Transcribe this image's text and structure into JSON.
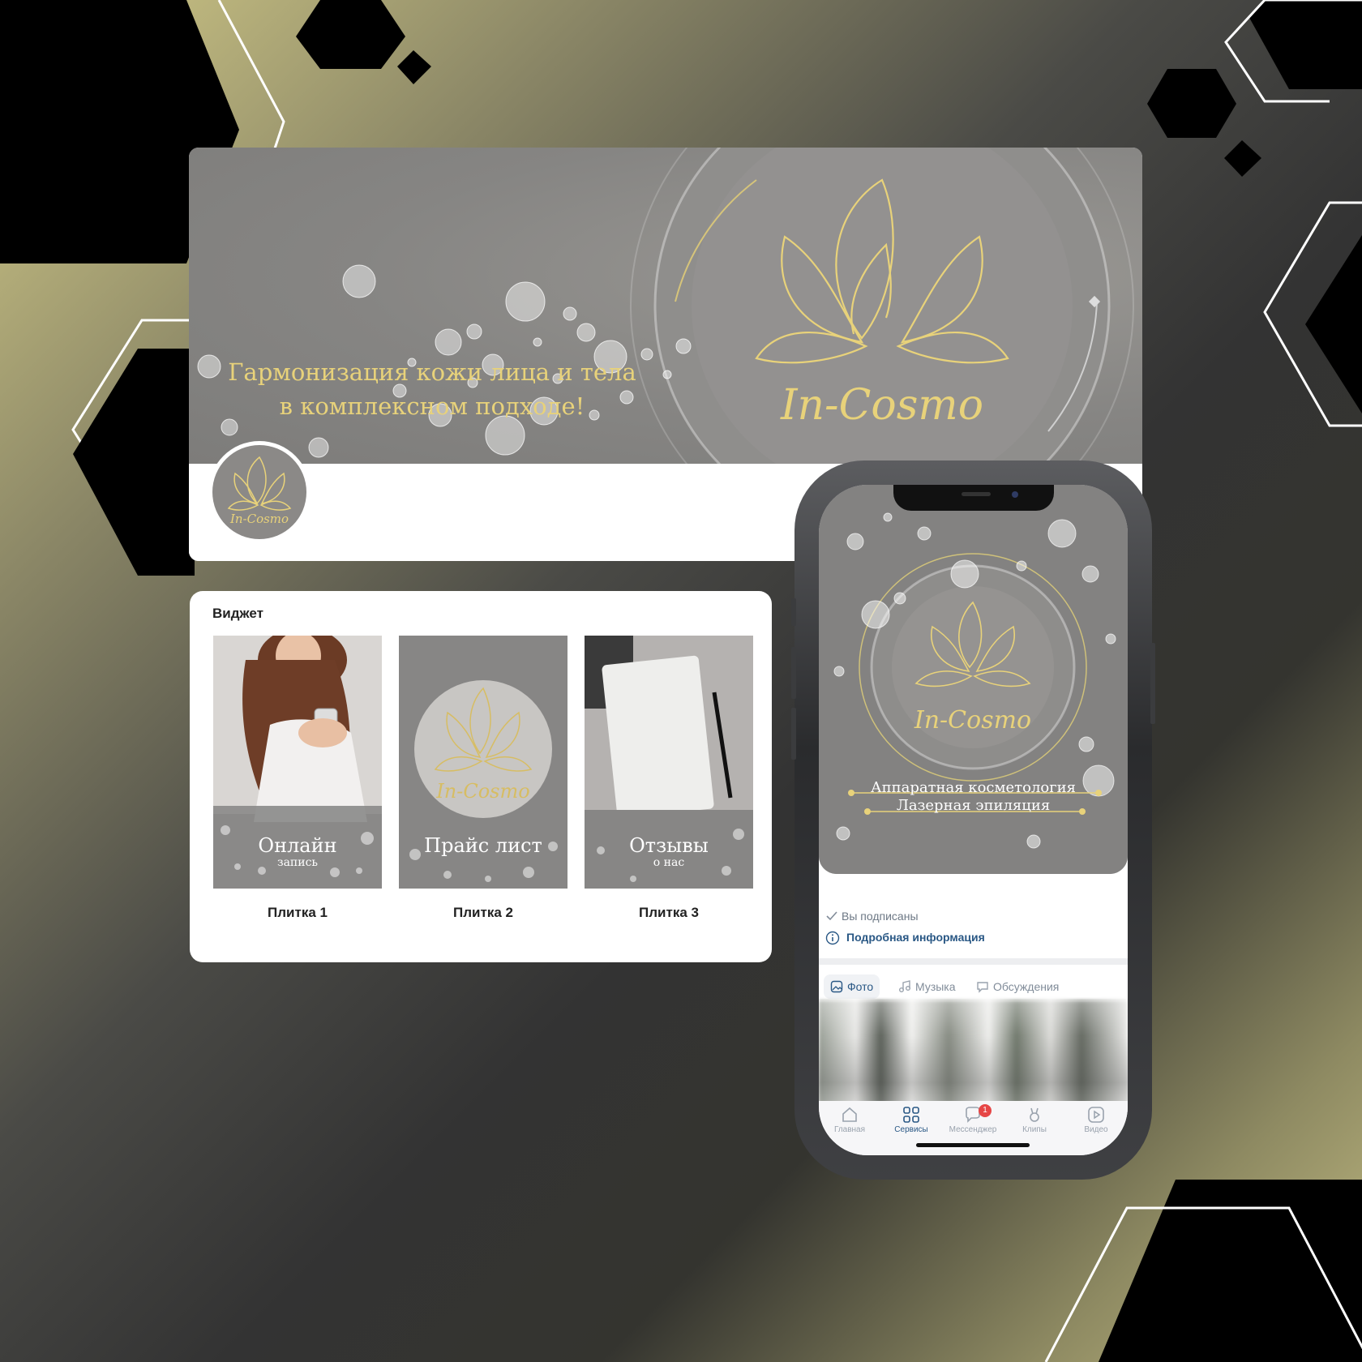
{
  "cover": {
    "tagline_line1": "Гармонизация кожи лица и тела",
    "tagline_line2": "в комплексном подходе!",
    "logo_text": "In-Cosmo"
  },
  "widget": {
    "title": "Виджет",
    "tiles": [
      {
        "title": "Онлайн",
        "subtitle": "запись",
        "caption": "Плитка 1"
      },
      {
        "title": "Прайс лист",
        "subtitle": "",
        "caption": "Плитка 2",
        "logo_text": "In-Cosmo"
      },
      {
        "title": "Отзывы",
        "subtitle": "о нас",
        "caption": "Плитка 3"
      }
    ]
  },
  "phone": {
    "logo_text": "In-Cosmo",
    "cover_line1": "Аппаратная косметология",
    "cover_line2": "Лазерная эпиляция",
    "subscribed": "Вы подписаны",
    "info_link": "Подробная информация",
    "tabs": [
      {
        "label": "Фото",
        "icon": "image-icon",
        "active": true
      },
      {
        "label": "Музыка",
        "icon": "music-note-icon",
        "active": false
      },
      {
        "label": "Обсуждения",
        "icon": "comment-icon",
        "active": false
      }
    ],
    "nav": [
      {
        "label": "Главная",
        "icon": "home-icon",
        "active": false
      },
      {
        "label": "Сервисы",
        "icon": "grid-icon",
        "active": true
      },
      {
        "label": "Мессенджер",
        "icon": "chat-icon",
        "active": false,
        "badge": "1"
      },
      {
        "label": "Клипы",
        "icon": "clips-icon",
        "active": false
      },
      {
        "label": "Видео",
        "icon": "video-icon",
        "active": false
      }
    ]
  },
  "colors": {
    "gold": "#e8d27a",
    "cover_gray": "#868583",
    "link_blue": "#2a5885",
    "badge_red": "#e64646"
  }
}
